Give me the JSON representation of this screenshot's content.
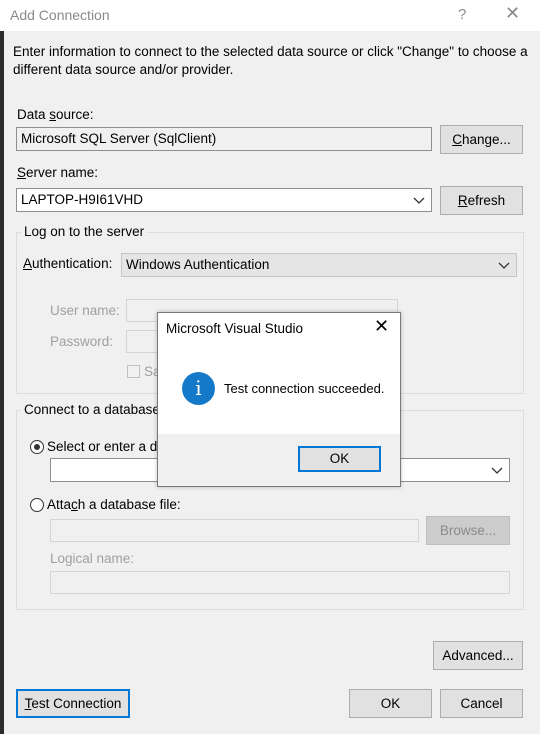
{
  "window": {
    "title": "Add Connection",
    "help_label": "?",
    "close_label": "✕"
  },
  "intro": "Enter information to connect to the selected data source or click \"Change\" to choose a different data source and/or provider.",
  "data_source": {
    "label_pre": "Data ",
    "label_u": "s",
    "label_post": "ource:",
    "value": "Microsoft SQL Server (SqlClient)",
    "change_pre": "",
    "change_u": "C",
    "change_post": "hange..."
  },
  "server": {
    "label_u": "S",
    "label_post": "erver name:",
    "value": "LAPTOP-H9I61VHD",
    "refresh_u": "R",
    "refresh_post": "efresh"
  },
  "logon": {
    "group_title": "Log on to the server",
    "auth_label_u": "A",
    "auth_label_post": "uthentication:",
    "auth_value": "Windows Authentication",
    "user_label": "User name:",
    "password_label": "Password:",
    "save_label": "Sa"
  },
  "database": {
    "group_title": "Connect to a database",
    "select_pre": "Select or enter a da",
    "select_u": "",
    "attach_pre": "Atta",
    "attach_u": "c",
    "attach_post": "h a database file:",
    "browse_label": "Browse...",
    "logical_label": "Logical name:"
  },
  "advanced_label": "Advanced...",
  "test_connection_u": "T",
  "test_connection_post": "est Connection",
  "ok_label": "OK",
  "cancel_label": "Cancel",
  "modal": {
    "title": "Microsoft Visual Studio",
    "close_label": "✕",
    "icon_glyph": "i",
    "message": "Test connection succeeded.",
    "ok_label": "OK"
  },
  "colors": {
    "accent": "#0078d7",
    "info_icon": "#1479c9"
  }
}
